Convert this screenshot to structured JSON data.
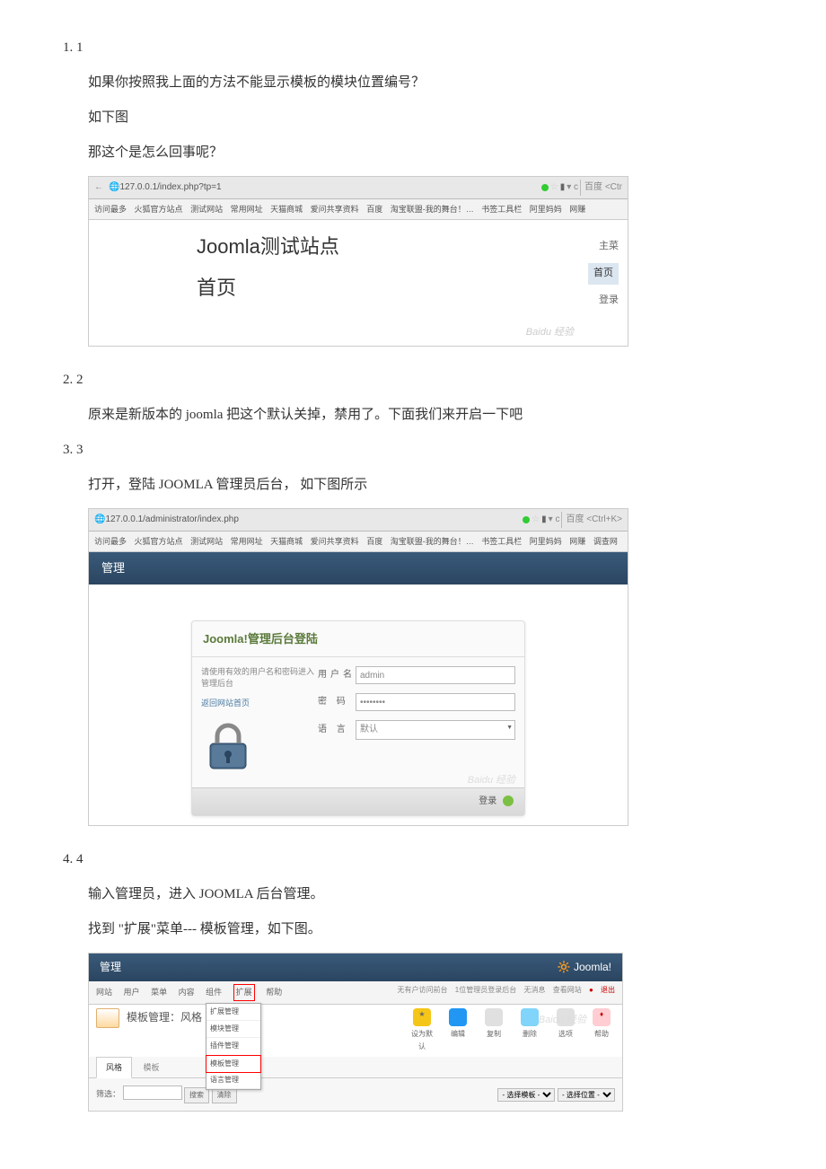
{
  "steps": {
    "s1": {
      "num": "1. 1",
      "p1": "如果你按照我上面的方法不能显示模板的模块位置编号？",
      "p2": "如下图",
      "p3": "那这个是怎么回事呢？"
    },
    "s2": {
      "num": "2. 2",
      "p1": "原来是新版本的 joomla 把这个默认关掉，禁用了。下面我们来开启一下吧"
    },
    "s3": {
      "num": "3. 3",
      "p1": "打开，登陆 JOOMLA 管理员后台， 如下图所示"
    },
    "s4": {
      "num": "4. 4",
      "p1": "输入管理员，进入 JOOMLA 后台管理。",
      "p2": "找到 \"扩展\"菜单--- 模板管理，如下图。"
    }
  },
  "ss1": {
    "url": "127.0.0.1/index.php?tp=1",
    "search_hint": "百度 <Ctr",
    "bookmarks": [
      "访问最多",
      "火狐官方站点",
      "测试网站",
      "常用网址",
      "天猫商城",
      "爱问共享资料",
      "百度",
      "淘宝联盟-我的舞台！…",
      "书签工具栏",
      "阿里妈妈",
      "网赚"
    ],
    "site_title": "Joomla测试站点",
    "page_title": "首页",
    "menu": [
      "主菜",
      "首页",
      "登录"
    ],
    "watermark": "Baidu 经验"
  },
  "ss2": {
    "url": "127.0.0.1/administrator/index.php",
    "search_hint": "百度 <Ctrl+K>",
    "bookmarks": [
      "访问最多",
      "火狐官方站点",
      "测试网站",
      "常用网址",
      "天猫商城",
      "爱问共享资料",
      "百度",
      "淘宝联盟-我的舞台！…",
      "书签工具栏",
      "阿里妈妈",
      "网赚",
      "调查网"
    ],
    "header": "管理",
    "login_title": "Joomla!管理后台登陆",
    "hint": "请使用有效的用户名和密码进入管理后台",
    "back_link": "返回网站首页",
    "labels": {
      "user": "用户名",
      "pass": "密 码",
      "lang": "语 言"
    },
    "values": {
      "user": "admin",
      "pass": "••••••••",
      "lang": "默认"
    },
    "login_btn": "登录",
    "watermark": "Baidu 经验"
  },
  "ss3": {
    "header": "管理",
    "logo": "Joomla!",
    "menu": [
      "网站",
      "用户",
      "菜单",
      "内容",
      "组件",
      "扩展",
      "帮助"
    ],
    "status": [
      "无有户访问前台",
      "1位管理员登录后台",
      "无消息",
      "查看网站",
      "退出"
    ],
    "heading": "模板管理：风格",
    "dropdown": [
      "扩展管理",
      "模块管理",
      "插件管理",
      "模板管理",
      "语言管理"
    ],
    "toolbar": [
      {
        "label": "设为默认",
        "color": "#f5c518"
      },
      {
        "label": "编辑",
        "color": "#2196f3"
      },
      {
        "label": "复制",
        "color": "#9e9e9e"
      },
      {
        "label": "删除",
        "color": "#03a9f4"
      },
      {
        "label": "选项",
        "color": "#9e9e9e"
      },
      {
        "label": "帮助",
        "color": "#f44336"
      }
    ],
    "tabs": [
      "风格",
      "模板"
    ],
    "filter": {
      "label": "筛选：",
      "search": "搜索",
      "clear": "清除",
      "sel1": "- 选择模板 -",
      "sel2": "- 选择位置 -"
    },
    "watermark": "Baidu 经验"
  }
}
